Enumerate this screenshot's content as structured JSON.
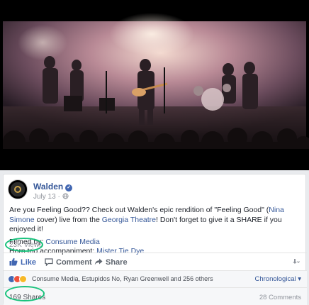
{
  "post": {
    "page_name": "Walden",
    "date": "July 13 ·",
    "text_part1": "Are you Feeling Good?? Check out Walden's epic rendition of \"Feeling Good\" (",
    "text_link1": "Nina Simone",
    "text_part2": " cover) live from the ",
    "text_link2": "Georgia Theatre",
    "text_part3": "! Don't forget to give it a SHARE if you enjoyed it!",
    "filmed_label": "Filmed by: ",
    "filmed_link": "Consume Media",
    "horn_label": "Horn trio accompaniment: ",
    "horn_link": "Mister Tie Dye",
    "views": "23K Views"
  },
  "actions": {
    "like": "Like",
    "comment": "Comment",
    "share": "Share"
  },
  "reactions": {
    "names": "Consume Media, Estupidos No, Ryan Greenwell and 256 others",
    "sort_label": "Chronological ▾"
  },
  "stats": {
    "shares": "169 Shares",
    "comments": "28 Comments"
  },
  "colors": {
    "link": "#365899",
    "like_blue": "#4267b2",
    "highlight_ring": "#19c37d"
  }
}
